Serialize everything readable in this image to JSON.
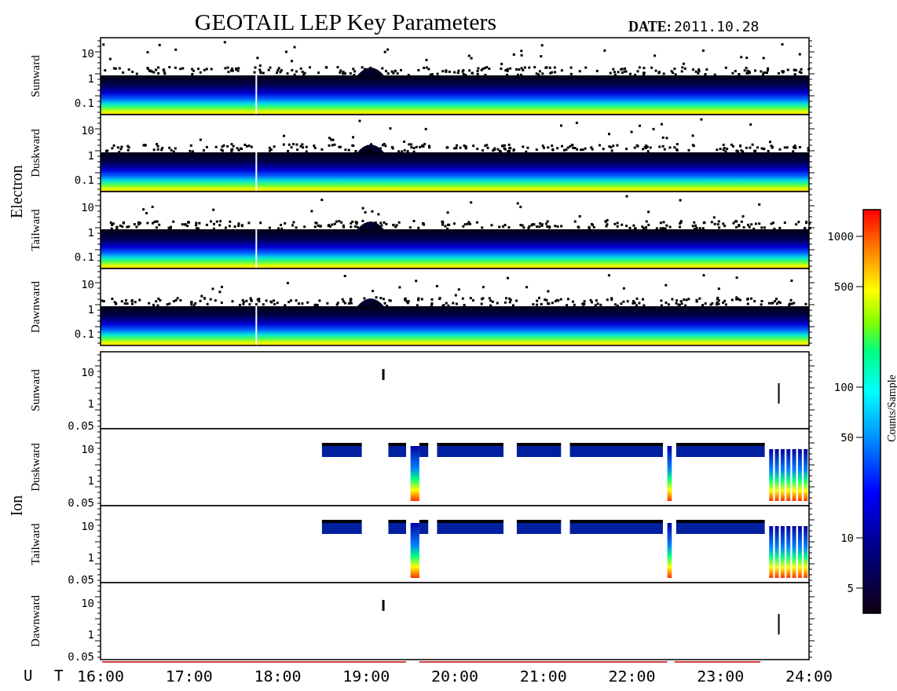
{
  "title": "GEOTAIL LEP Key Parameters",
  "date_label": "DATE:",
  "date": "2011.10.28",
  "groups": [
    {
      "label": "Electron",
      "kind": "electron",
      "panels": [
        {
          "label": "Sunward",
          "yticks": [
            "10",
            "1",
            "0.1"
          ]
        },
        {
          "label": "Duskward",
          "yticks": [
            "10",
            "1",
            "0.1"
          ]
        },
        {
          "label": "Tailward",
          "yticks": [
            "10",
            "1",
            "0.1"
          ]
        },
        {
          "label": "Dawnward",
          "yticks": [
            "10",
            "1",
            "0.1"
          ]
        }
      ]
    },
    {
      "label": "Ion",
      "kind": "ion",
      "panels": [
        {
          "label": "Sunward",
          "yticks": [
            "10",
            "1",
            "0.05"
          ]
        },
        {
          "label": "Duskward",
          "yticks": [
            "10",
            "1",
            "0.05"
          ]
        },
        {
          "label": "Tailward",
          "yticks": [
            "10",
            "1",
            "0.05"
          ]
        },
        {
          "label": "Dawnward",
          "yticks": [
            "10",
            "1",
            "0.05"
          ]
        }
      ]
    }
  ],
  "x_axis": {
    "label": "U T",
    "ticks": [
      "16:00",
      "17:00",
      "18:00",
      "19:00",
      "20:00",
      "21:00",
      "22:00",
      "23:00",
      "24:00"
    ]
  },
  "colorbar": {
    "label": "Counts/Sample",
    "ticks": [
      "1000",
      "500",
      "100",
      "50",
      "10",
      "5"
    ]
  }
}
